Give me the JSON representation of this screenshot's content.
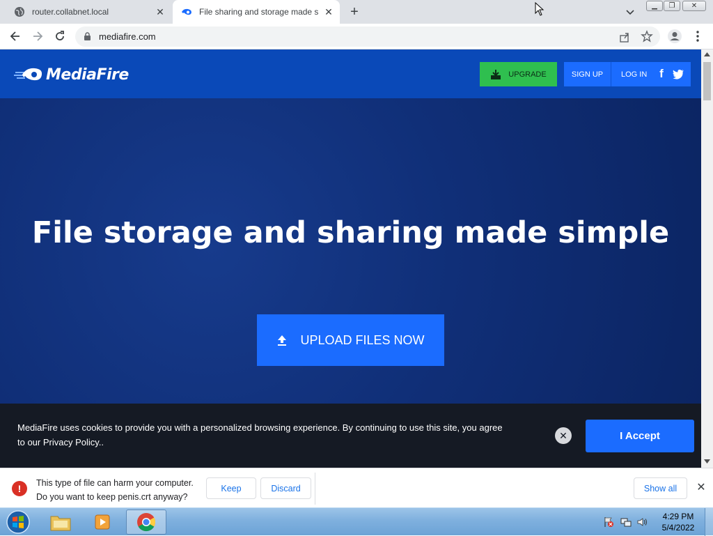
{
  "browser": {
    "tabs": [
      {
        "title": "router.collabnet.local",
        "active": false
      },
      {
        "title": "File sharing and storage made simple",
        "active": true
      }
    ],
    "url": "mediafire.com"
  },
  "site": {
    "logo_text": "MediaFire",
    "upgrade_label": "UPGRADE",
    "signup_label": "SIGN UP",
    "login_label": "LOG IN",
    "hero_title": "File storage and sharing made simple",
    "upload_label": "UPLOAD FILES NOW",
    "brand_color": "#0a49b8",
    "accent_color": "#1b6cff",
    "upgrade_color": "#2fbf4f"
  },
  "cookie_banner": {
    "text": "MediaFire uses cookies to provide you with a personalized browsing experience. By continuing to use this site, you agree to our Privacy Policy..",
    "accept_label": "I Accept"
  },
  "download_bar": {
    "warning_line1": "This type of file can harm your computer.",
    "warning_line2": "Do you want to keep penis.crt anyway?",
    "keep_label": "Keep",
    "discard_label": "Discard",
    "show_all_label": "Show all"
  },
  "taskbar": {
    "time": "4:29 PM",
    "date": "5/4/2022"
  }
}
